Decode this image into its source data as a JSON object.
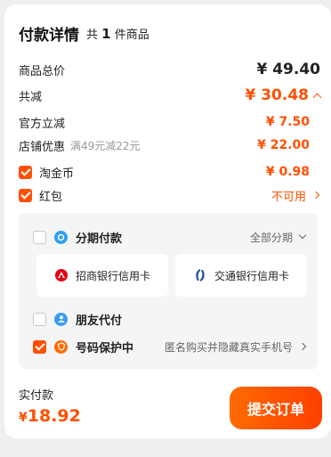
{
  "header": {
    "title": "付款详情",
    "count_prefix": "共",
    "count": "1",
    "count_suffix": "件商品"
  },
  "rows": {
    "total": {
      "label": "商品总价",
      "value": "¥ 49.40"
    },
    "discount": {
      "label": "共减",
      "value": "¥ 30.48"
    },
    "official": {
      "label": "官方立减",
      "value": "¥ 7.50"
    },
    "shop": {
      "label": "店铺优惠",
      "sub": "满49元减22元",
      "value": "¥ 22.00"
    },
    "taojinbi": {
      "label": "淘金币",
      "value": "¥ 0.98",
      "checked": true
    },
    "hongbao": {
      "label": "红包",
      "value": "不可用",
      "checked": true
    }
  },
  "installment": {
    "label": "分期付款",
    "option": "全部分期",
    "banks": [
      "招商银行信用卡",
      "交通银行信用卡"
    ]
  },
  "friend_pay": {
    "label": "朋友代付"
  },
  "number_protect": {
    "label": "号码保护中",
    "desc": "匿名购买并隐藏真实手机号"
  },
  "footer": {
    "pay_label": "实付款",
    "currency": "¥",
    "amount": "18.92",
    "submit": "提交订单"
  },
  "colors": {
    "accent": "#ff5000",
    "installment_icon": "#2ea0f0",
    "friend_icon": "#3a9cf0",
    "protect_icon": "#ff6a00"
  }
}
